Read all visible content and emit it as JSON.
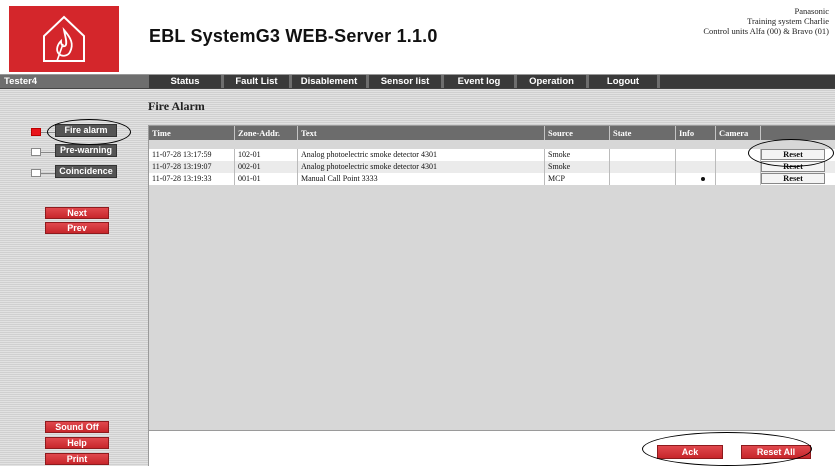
{
  "header": {
    "title": "EBL SystemG3 WEB-Server 1.1.0",
    "info_line1": "Panasonic",
    "info_line2": "Training system Charlie",
    "info_line3": "Control units Alfa (00) & Bravo (01)"
  },
  "nav": {
    "user": "Tester4",
    "items": [
      "Status",
      "Fault List",
      "Disablement",
      "Sensor list",
      "Event log",
      "Operation",
      "Logout"
    ]
  },
  "sidebar": {
    "alarm_types": [
      "Fire alarm",
      "Pre-warning",
      "Coincidence"
    ],
    "next": "Next",
    "prev": "Prev",
    "sound_off": "Sound Off",
    "help": "Help",
    "print": "Print"
  },
  "main": {
    "title": "Fire Alarm",
    "columns": [
      "Time",
      "Zone-Addr.",
      "Text",
      "Source",
      "State",
      "Info",
      "Camera"
    ],
    "rows": [
      {
        "time": "11-07-28 13:17:59",
        "zone": "102-01",
        "text": "Analog photoelectric smoke detector 4301",
        "source": "Smoke",
        "state": "",
        "reset": "Reset"
      },
      {
        "time": "11-07-28 13:19:07",
        "zone": "002-01",
        "text": "Analog photoelectric smoke detector 4301",
        "source": "Smoke",
        "state": "",
        "reset": "Reset"
      },
      {
        "time": "11-07-28 13:19:33",
        "zone": "001-01",
        "text": "Manual Call Point 3333",
        "source": "MCP",
        "state": "",
        "reset": "Reset"
      }
    ],
    "ack": "Ack",
    "reset_all": "Reset All"
  },
  "colors": {
    "brand_red": "#d4262b",
    "nav_dark": "#3a3a3a",
    "active_indicator": "#e8141b"
  }
}
